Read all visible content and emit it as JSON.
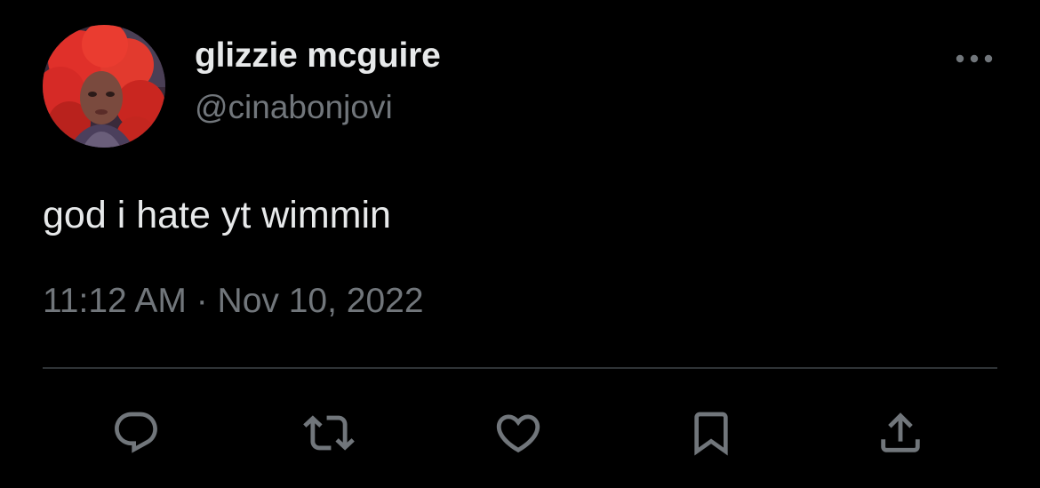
{
  "user": {
    "display_name": "glizzie mcguire",
    "handle": "@cinabonjovi",
    "avatar_icon": "profile-photo"
  },
  "tweet": {
    "text": "god i hate yt wimmin",
    "timestamp": "11:12 AM · Nov 10, 2022"
  },
  "actions": [
    {
      "name": "reply",
      "icon": "speech-bubble-icon"
    },
    {
      "name": "retweet",
      "icon": "retweet-arrows-icon"
    },
    {
      "name": "like",
      "icon": "heart-icon"
    },
    {
      "name": "bookmark",
      "icon": "bookmark-icon"
    },
    {
      "name": "share",
      "icon": "share-upload-icon"
    }
  ],
  "more_icon": "ellipsis-icon",
  "colors": {
    "background": "#000000",
    "primary_text": "#e7e9ea",
    "secondary_text": "#71767b",
    "divider": "#2f3336",
    "icon": "#71767b"
  }
}
